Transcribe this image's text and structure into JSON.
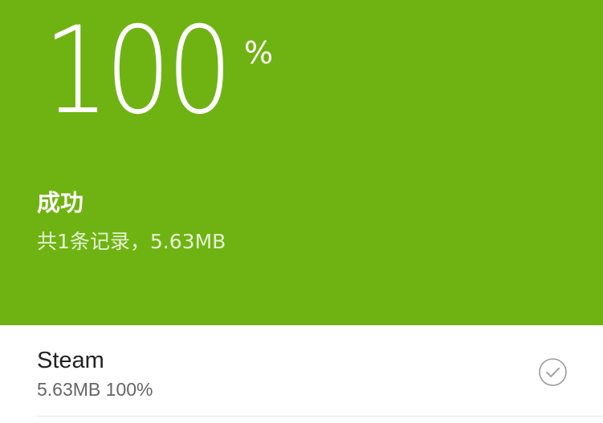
{
  "progress": {
    "value": "100",
    "unit": "%"
  },
  "status": {
    "title": "成功",
    "summary": "共1条记录，5.63MB"
  },
  "records": [
    {
      "name": "Steam",
      "meta": "5.63MB 100%",
      "icon": "check-circle-icon"
    }
  ],
  "colors": {
    "accent": "#6fb312",
    "hero_text": "#ffffff",
    "subtext": "#e6f2d6",
    "list_title": "#222222",
    "list_meta": "#666666",
    "check": "#9a9a9a"
  }
}
